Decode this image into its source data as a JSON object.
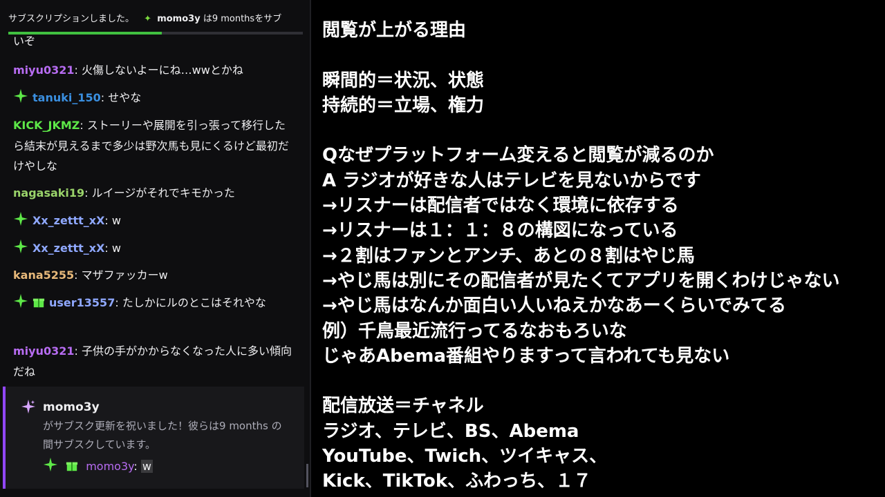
{
  "colors": {
    "chat_bg": "#0e0e10",
    "sub_accent": "#9147ff",
    "progress": "#40c040"
  },
  "ticker": {
    "text_before": "サブスクリプションしました。",
    "user": "momo3y",
    "text_after": "は9 monthsをサブ"
  },
  "progress": {
    "fraction": 0.52
  },
  "chat": {
    "continuation": "いぞ",
    "messages": [
      {
        "user": "miyu0321",
        "color": "#b76cf2",
        "badges": [],
        "text": "火傷しないよーにね…wwとかね"
      },
      {
        "user": "tanuki_150",
        "color": "#3a8fe0",
        "badges": [
          "sparkle-icon"
        ],
        "text": "せやな"
      },
      {
        "user": "KICK_JKMZ",
        "color": "#5ee848",
        "badges": [],
        "text": "ストーリーや展開を引っ張って移行したら結末が見えるまで多少は野次馬も見にくるけど最初だけやしな"
      },
      {
        "user": "nagasaki19",
        "color": "#9ad36a",
        "badges": [],
        "text": "ルイージがそれでキモかった"
      },
      {
        "user": "Xx_zettt_xX",
        "color": "#8fa8ff",
        "badges": [
          "sparkle-icon"
        ],
        "text": "w"
      },
      {
        "user": "Xx_zettt_xX",
        "color": "#8fa8ff",
        "badges": [
          "sparkle-icon"
        ],
        "text": "w"
      },
      {
        "user": "kana5255",
        "color": "#e8b97a",
        "badges": [],
        "text": "マザファッカーw"
      },
      {
        "user": "user13557",
        "color": "#8fa8ff",
        "badges": [
          "sparkle-icon",
          "gift-icon"
        ],
        "text": "たしかにルのとこはそれやな"
      },
      {
        "user": "miyu0321",
        "color": "#b76cf2",
        "badges": [],
        "text": "子供の手がかからなくなった人に多い傾向だね"
      }
    ]
  },
  "sub_card": {
    "user": "momo3y",
    "text": "がサブスク更新を祝いました！彼らは9 months の間サブスクしています。",
    "msg_user": "momo3y",
    "msg_user_color": "#b76cf2",
    "msg_text": "w"
  },
  "notes": {
    "lines": [
      "閲覧が上がる理由",
      "",
      "瞬間的＝状況、状態",
      "持続的＝立場、権力",
      "",
      "Qなぜプラットフォーム変えると閲覧が減るのか",
      "A ラジオが好きな人はテレビを見ないからです",
      "→リスナーは配信者ではなく環境に依存する",
      "→リスナーは１：１：８の構図になっている",
      "→２割はファンとアンチ、あとの８割はやじ馬",
      "→やじ馬は別にその配信者が見たくてアプリを開くわけじゃない",
      "→やじ馬はなんか面白い人いねえかなあーくらいでみてる",
      "例）千鳥最近流行ってるなおもろいな",
      "じゃあAbema番組やりますって言われても見ない",
      "",
      "配信放送＝チャネル",
      "ラジオ、テレビ、BS、Abema",
      "YouTube、Twich、ツイキャス、",
      "Kick、TikTok、ふわっち、１７"
    ]
  }
}
